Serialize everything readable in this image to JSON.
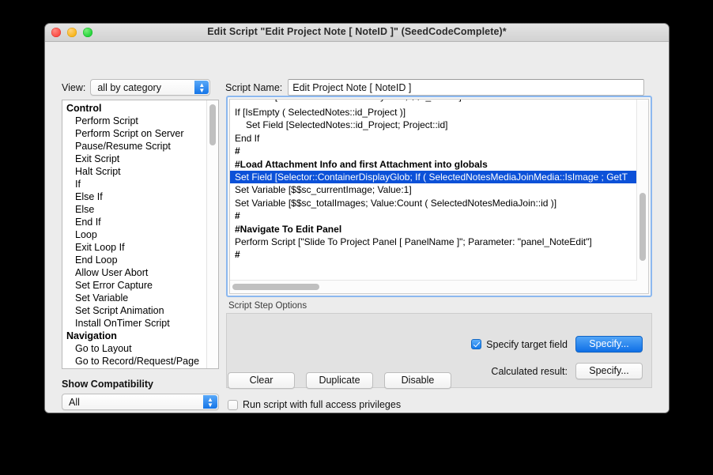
{
  "window": {
    "title": "Edit Script \"Edit Project Note [ NoteID ]\" (SeedCodeComplete)*",
    "traffic": {
      "close": "close-button",
      "minimize": "minimize-button",
      "zoom": "zoom-button"
    }
  },
  "toolbar": {
    "view_label": "View:",
    "view_value": "all by category",
    "script_name_label": "Script Name:",
    "script_name_value": "Edit Project Note [ NoteID ]"
  },
  "steps_list": {
    "items": [
      {
        "label": "Control",
        "type": "category"
      },
      {
        "label": "Perform Script",
        "type": "step"
      },
      {
        "label": "Perform Script on Server",
        "type": "step"
      },
      {
        "label": "Pause/Resume Script",
        "type": "step"
      },
      {
        "label": "Exit Script",
        "type": "step"
      },
      {
        "label": "Halt Script",
        "type": "step"
      },
      {
        "label": "If",
        "type": "step"
      },
      {
        "label": "Else If",
        "type": "step"
      },
      {
        "label": "Else",
        "type": "step"
      },
      {
        "label": "End If",
        "type": "step"
      },
      {
        "label": "Loop",
        "type": "step"
      },
      {
        "label": "Exit Loop If",
        "type": "step"
      },
      {
        "label": "End Loop",
        "type": "step"
      },
      {
        "label": "Allow User Abort",
        "type": "step"
      },
      {
        "label": "Set Error Capture",
        "type": "step"
      },
      {
        "label": "Set Variable",
        "type": "step"
      },
      {
        "label": "Set Script Animation",
        "type": "step"
      },
      {
        "label": "Install OnTimer Script",
        "type": "step"
      },
      {
        "label": "Navigation",
        "type": "category"
      },
      {
        "label": "Go to Layout",
        "type": "step"
      },
      {
        "label": "Go to Record/Request/Page",
        "type": "step"
      }
    ]
  },
  "compatibility": {
    "label": "Show Compatibility",
    "value": "All"
  },
  "script": {
    "lines": [
      {
        "text": "Set Field [Selector::SelectNotesKeyGlob; $$c_noteID]",
        "style": "clipped",
        "selected": false
      },
      {
        "text": "If [IsEmpty ( SelectedNotes::id_Project )]",
        "style": "normal",
        "selected": false
      },
      {
        "text": "Set Field [SelectedNotes::id_Project; Project::id]",
        "style": "indent1",
        "selected": false
      },
      {
        "text": "End If",
        "style": "normal",
        "selected": false
      },
      {
        "text": "#",
        "style": "comment",
        "selected": false
      },
      {
        "text": "#Load Attachment Info and first Attachment into globals",
        "style": "comment",
        "selected": false
      },
      {
        "text": "Set Field [Selector::ContainerDisplayGlob; If ( SelectedNotesMediaJoinMedia::IsImage ;  GetT",
        "style": "normal",
        "selected": true
      },
      {
        "text": "Set Variable [$$sc_currentImage; Value:1]",
        "style": "normal",
        "selected": false
      },
      {
        "text": "Set Variable [$$sc_totalImages; Value:Count ( SelectedNotesMediaJoin::id )]",
        "style": "normal",
        "selected": false
      },
      {
        "text": "#",
        "style": "comment",
        "selected": false
      },
      {
        "text": "#Navigate To Edit Panel",
        "style": "comment",
        "selected": false
      },
      {
        "text": "Perform Script [\"Slide To Project Panel [ PanelName ]\"; Parameter: \"panel_NoteEdit\"]",
        "style": "normal",
        "selected": false
      },
      {
        "text": "#",
        "style": "comment",
        "selected": false
      }
    ]
  },
  "options": {
    "title": "Script Step Options",
    "specify_target_field_label": "Specify target field",
    "specify_target_field_checked": true,
    "specify_target_button": "Specify...",
    "calculated_result_label": "Calculated result:",
    "calculated_result_button": "Specify..."
  },
  "bottom": {
    "clear": "Clear",
    "duplicate": "Duplicate",
    "disable": "Disable",
    "run_privileges_label": "Run script with full access privileges",
    "run_privileges_checked": false
  },
  "colors": {
    "selection_blue": "#0c51d8",
    "primary_button": "#1079ea",
    "window_bg": "#ececec",
    "focus_ring": "#8cb8ef"
  }
}
